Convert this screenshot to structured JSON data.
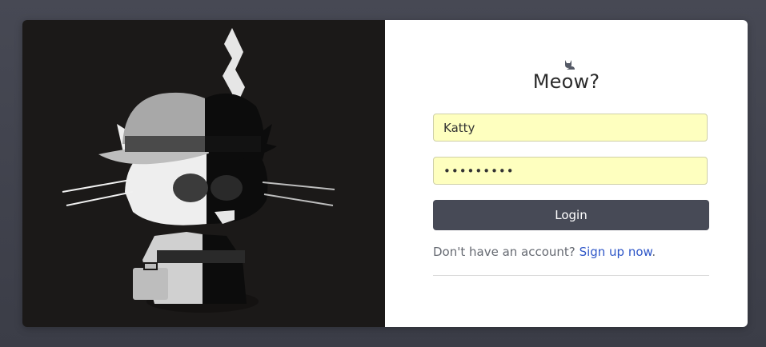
{
  "login": {
    "title": "Meow?",
    "brand_icon": "cat-icon",
    "username_value": "Katty",
    "password_value": "•••••••••",
    "login_label": "Login",
    "signup_prompt": "Don't have an account?",
    "signup_link": "Sign up now",
    "signup_suffix": "."
  },
  "colors": {
    "page_background": "#40424c",
    "art_background": "#1b1918",
    "field_background": "#feffbf",
    "button_background": "#474a56",
    "link": "#2f57c8"
  }
}
